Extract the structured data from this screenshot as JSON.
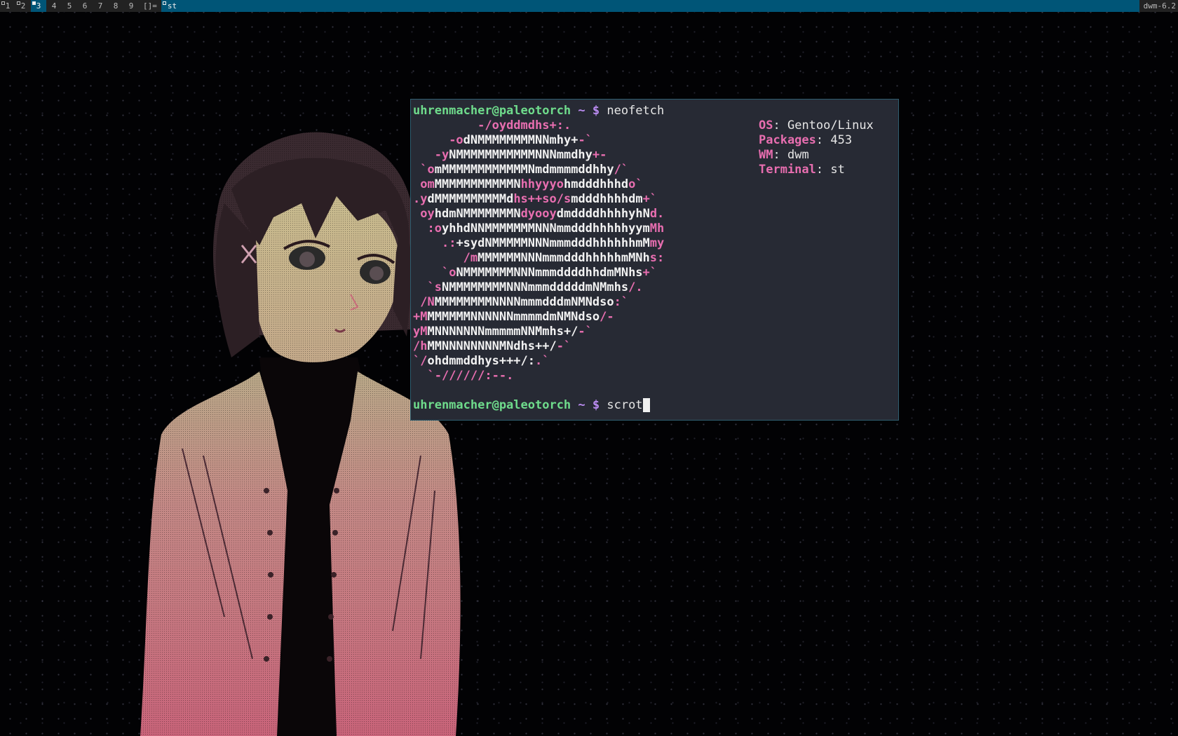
{
  "bar": {
    "tags": [
      {
        "label": "1",
        "occupied": true,
        "selected": false
      },
      {
        "label": "2",
        "occupied": true,
        "selected": false
      },
      {
        "label": "3",
        "occupied": true,
        "selected": true
      },
      {
        "label": "4",
        "occupied": false,
        "selected": false
      },
      {
        "label": "5",
        "occupied": false,
        "selected": false
      },
      {
        "label": "6",
        "occupied": false,
        "selected": false
      },
      {
        "label": "7",
        "occupied": false,
        "selected": false
      },
      {
        "label": "8",
        "occupied": false,
        "selected": false
      },
      {
        "label": "9",
        "occupied": false,
        "selected": false
      }
    ],
    "layout_symbol": "[]=",
    "window_title": "st",
    "status": "dwm-6.2"
  },
  "terminal": {
    "prompt_user": "uhrenmacher@paleotorch",
    "prompt_dir": " ~ $ ",
    "first_command": "neofetch",
    "current_input": "scrot",
    "logo_lines": [
      [
        [
          "w",
          "         "
        ],
        [
          "p",
          "-/oyddmdhs+:."
        ]
      ],
      [
        [
          "w",
          "     "
        ],
        [
          "p",
          "-o"
        ],
        [
          "w",
          "dNMMMMMMMMNNmhy+"
        ],
        [
          "p",
          "-`"
        ]
      ],
      [
        [
          "w",
          "   "
        ],
        [
          "p",
          "-y"
        ],
        [
          "w",
          "NMMMMMMMMMMMNNNmmdhy"
        ],
        [
          "p",
          "+-"
        ]
      ],
      [
        [
          "w",
          " "
        ],
        [
          "p",
          "`o"
        ],
        [
          "w",
          "mMMMMMMMMMMMMNmdmmmmddhhy"
        ],
        [
          "p",
          "/`"
        ]
      ],
      [
        [
          "w",
          " "
        ],
        [
          "p",
          "om"
        ],
        [
          "w",
          "MMMMMMMMMMMN"
        ],
        [
          "p",
          "hhyyyo"
        ],
        [
          "w",
          "hmdddhhhd"
        ],
        [
          "p",
          "o`"
        ]
      ],
      [
        [
          "p",
          ".y"
        ],
        [
          "w",
          "dMMMMMMMMMMd"
        ],
        [
          "p",
          "hs++so/s"
        ],
        [
          "w",
          "mdddhhhhdm"
        ],
        [
          "p",
          "+`"
        ]
      ],
      [
        [
          "w",
          " "
        ],
        [
          "p",
          "oy"
        ],
        [
          "w",
          "hdmNMMMMMMMN"
        ],
        [
          "p",
          "dyooy"
        ],
        [
          "w",
          "dmddddhhhhyhN"
        ],
        [
          "p",
          "d."
        ]
      ],
      [
        [
          "w",
          "  "
        ],
        [
          "p",
          ":o"
        ],
        [
          "w",
          "yhhdNNMMMMMMMNNNmmdddhhhhhyym"
        ],
        [
          "p",
          "Mh"
        ]
      ],
      [
        [
          "w",
          "    "
        ],
        [
          "p",
          ".:"
        ],
        [
          "w",
          "+sydNMMMMMNNNmmmdddhhhhhhmM"
        ],
        [
          "p",
          "my"
        ]
      ],
      [
        [
          "w",
          "       "
        ],
        [
          "p",
          "/m"
        ],
        [
          "w",
          "MMMMMMNNNmmmdddhhhhhmMNh"
        ],
        [
          "p",
          "s:"
        ]
      ],
      [
        [
          "w",
          "    "
        ],
        [
          "p",
          "`o"
        ],
        [
          "w",
          "NMMMMMMMNNNmmmddddhhdmMNhs"
        ],
        [
          "p",
          "+`"
        ]
      ],
      [
        [
          "w",
          "  "
        ],
        [
          "p",
          "`s"
        ],
        [
          "w",
          "NMMMMMMMMNNNmmmdddddmNMmhs"
        ],
        [
          "p",
          "/."
        ]
      ],
      [
        [
          "w",
          " "
        ],
        [
          "p",
          "/N"
        ],
        [
          "w",
          "MMMMMMMMNNNNmmmdddmNMNdso"
        ],
        [
          "p",
          ":`"
        ]
      ],
      [
        [
          "p",
          "+M"
        ],
        [
          "w",
          "MMMMMMNNNNNNmmmmdmNMNdso"
        ],
        [
          "p",
          "/-"
        ]
      ],
      [
        [
          "p",
          "yM"
        ],
        [
          "w",
          "MNNNNNNNmmmmmNNMmhs+/"
        ],
        [
          "p",
          "-`"
        ]
      ],
      [
        [
          "p",
          "/h"
        ],
        [
          "w",
          "MMNNNNNNNNMNdhs++/"
        ],
        [
          "p",
          "-`"
        ]
      ],
      [
        [
          "p",
          "`/"
        ],
        [
          "w",
          "ohdmmddhys+++/:"
        ],
        [
          "p",
          ".`"
        ]
      ],
      [
        [
          "w",
          "  "
        ],
        [
          "p",
          "`-//////:--."
        ]
      ]
    ],
    "info": [
      {
        "key": "OS",
        "value": "Gentoo/Linux"
      },
      {
        "key": "Packages",
        "value": "453"
      },
      {
        "key": "WM",
        "value": "dwm"
      },
      {
        "key": "Terminal",
        "value": "st"
      }
    ]
  },
  "colors": {
    "bar_bg": "#222222",
    "bar_selected": "#005577",
    "terminal_bg": "#272a34",
    "prompt_green": "#6fdc8c",
    "prompt_purple": "#bb8cf2",
    "logo_pink": "#e86eb0"
  }
}
